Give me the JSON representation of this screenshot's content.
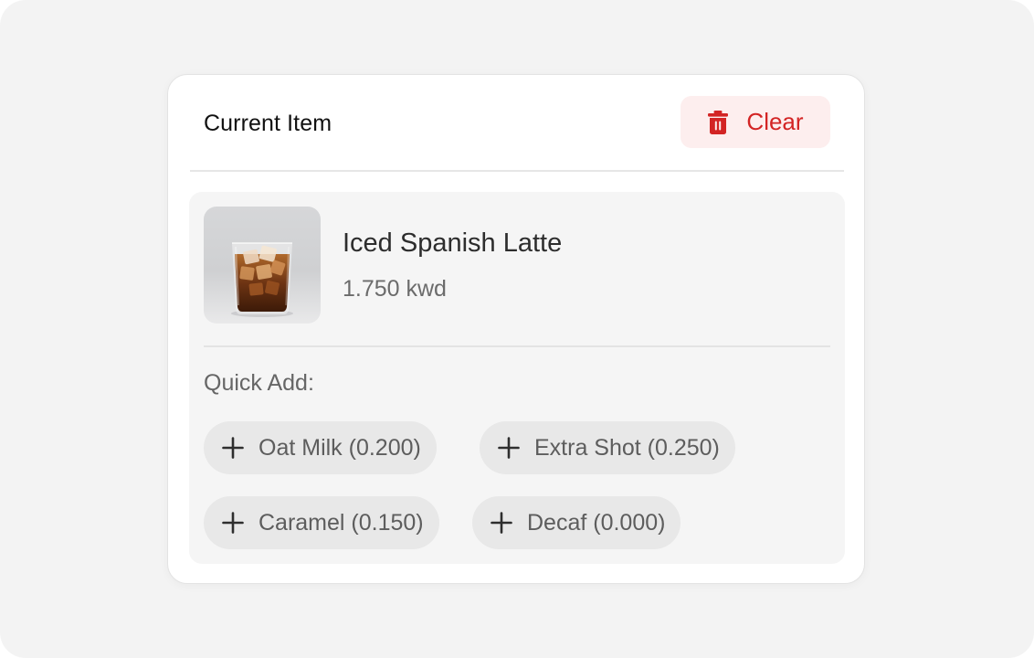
{
  "panel": {
    "title": "Current Item",
    "clear_button": {
      "label": "Clear",
      "icon": "trash-icon",
      "color": "#d32424"
    }
  },
  "item": {
    "name": "Iced Spanish Latte",
    "price": "1.750 kwd",
    "image": "iced-coffee-glass"
  },
  "quick_add": {
    "label": "Quick Add:",
    "options": [
      {
        "label": "Oat Milk (0.200)",
        "icon": "plus-icon"
      },
      {
        "label": "Extra Shot (0.250)",
        "icon": "plus-icon"
      },
      {
        "label": "Caramel (0.150)",
        "icon": "plus-icon"
      },
      {
        "label": "Decaf (0.000)",
        "icon": "plus-icon"
      }
    ]
  }
}
